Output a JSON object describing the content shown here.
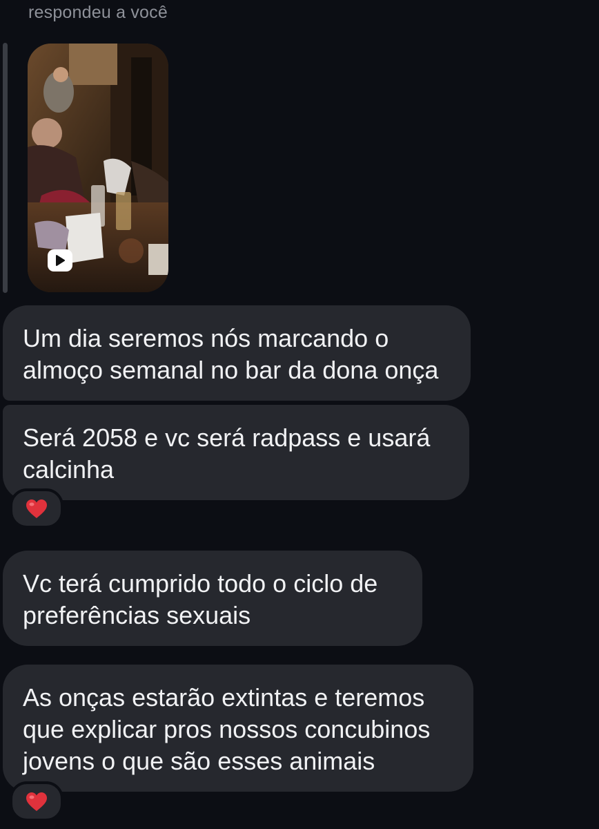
{
  "reply_context": "respondeu a você",
  "media": {
    "type": "video",
    "icon": "play-icon"
  },
  "messages": [
    {
      "text": "Um dia seremos nós marcando o\nalmoço semanal no bar da dona onça",
      "reaction": null
    },
    {
      "text": "Será 2058 e vc será radpass e usará\ncalcinha",
      "reaction": "heart"
    },
    {
      "text": "Vc terá cumprido todo o ciclo de\npreferências sexuais",
      "reaction": null
    },
    {
      "text": "As onças estarão extintas e teremos\nque explicar pros nossos concubinos\njovens o que são esses animais",
      "reaction": "heart"
    }
  ],
  "colors": {
    "background": "#0c0e14",
    "bubble": "#26282e",
    "secondary_text": "#8e9199",
    "heart": "#e0323c"
  }
}
